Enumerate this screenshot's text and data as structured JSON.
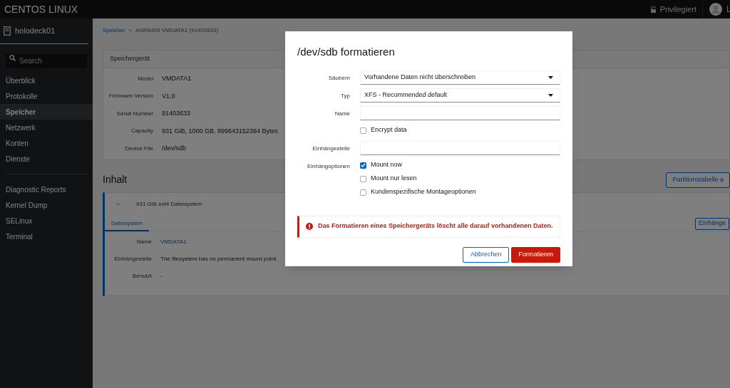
{
  "topbar": {
    "brand": "CENTOS LINUX",
    "privilege": "Privilegiert",
    "user": "L"
  },
  "sidebar": {
    "host": "holodeck01",
    "search": {
      "placeholder": "Search"
    },
    "items": [
      {
        "label": "Überblick",
        "selected": false
      },
      {
        "label": "Protokolle",
        "selected": false
      },
      {
        "label": "Speicher",
        "selected": true
      },
      {
        "label": "Netzwerk",
        "selected": false
      },
      {
        "label": "Konten",
        "selected": false
      },
      {
        "label": "Dienste",
        "selected": false
      }
    ],
    "tools": [
      {
        "label": "Diagnostic Reports",
        "selected": false
      },
      {
        "label": "Kernel Dump",
        "selected": false
      },
      {
        "label": "SELinux",
        "selected": false
      },
      {
        "label": "Terminal",
        "selected": false
      }
    ]
  },
  "breadcrumb": {
    "link": "Speicher",
    "separator": ">",
    "current": "ASR8405 VMDATA1 (91403633)"
  },
  "device_card": {
    "title": "Speichergerät",
    "rows": [
      {
        "label": "Model",
        "value": "VMDATA1"
      },
      {
        "label": "Firmware Version",
        "value": "V1.0"
      },
      {
        "label": "Serial Number",
        "value": "91403633"
      },
      {
        "label": "Capacity",
        "value": "931 GiB, 1000 GB, 999643152384 Bytes"
      },
      {
        "label": "Device File",
        "value": "/dev/sdb"
      }
    ]
  },
  "content": {
    "title": "Inhalt",
    "action": "Partitionstabelle a",
    "entry": "931 GiB ext4 Dateisystem",
    "tab": "Dateisystem",
    "tab_action": "Einhänge",
    "rows": [
      {
        "label": "Name",
        "value": "VMDATA1",
        "kind": "link"
      },
      {
        "label": "Einhängestelle",
        "value": "The filesystem has no permanent mount point.",
        "kind": "text"
      },
      {
        "label": "Benutzt",
        "value": "-",
        "kind": "text"
      }
    ]
  },
  "dialog": {
    "title": "/dev/sdb formatieren",
    "fields": [
      {
        "label": "Säubern",
        "kind": "select",
        "value": "Vorhandene Daten nicht überschreiben"
      },
      {
        "label": "Typ",
        "kind": "select",
        "value": "XFS - Recommended default"
      },
      {
        "label": "Name",
        "kind": "input"
      },
      {
        "kind": "checkbox",
        "options": [
          {
            "label": "Encrypt data",
            "checked": false
          }
        ]
      },
      {
        "label": "Einhängestelle",
        "kind": "input"
      },
      {
        "label": "Einhängoptionen",
        "kind": "checkbox",
        "options": [
          {
            "label": "Mount now",
            "checked": true
          },
          {
            "label": "Mount nur lesen",
            "checked": false
          },
          {
            "label": "Kundenspezifische Montageoptionen",
            "checked": false
          }
        ]
      }
    ],
    "alert": "Das Formatieren eines Speichergeräts löscht alle darauf vorhandenen Daten.",
    "buttons": [
      {
        "label": "Abbrechen",
        "kind": "secondary"
      },
      {
        "label": "Formatieren",
        "kind": "danger"
      }
    ]
  }
}
